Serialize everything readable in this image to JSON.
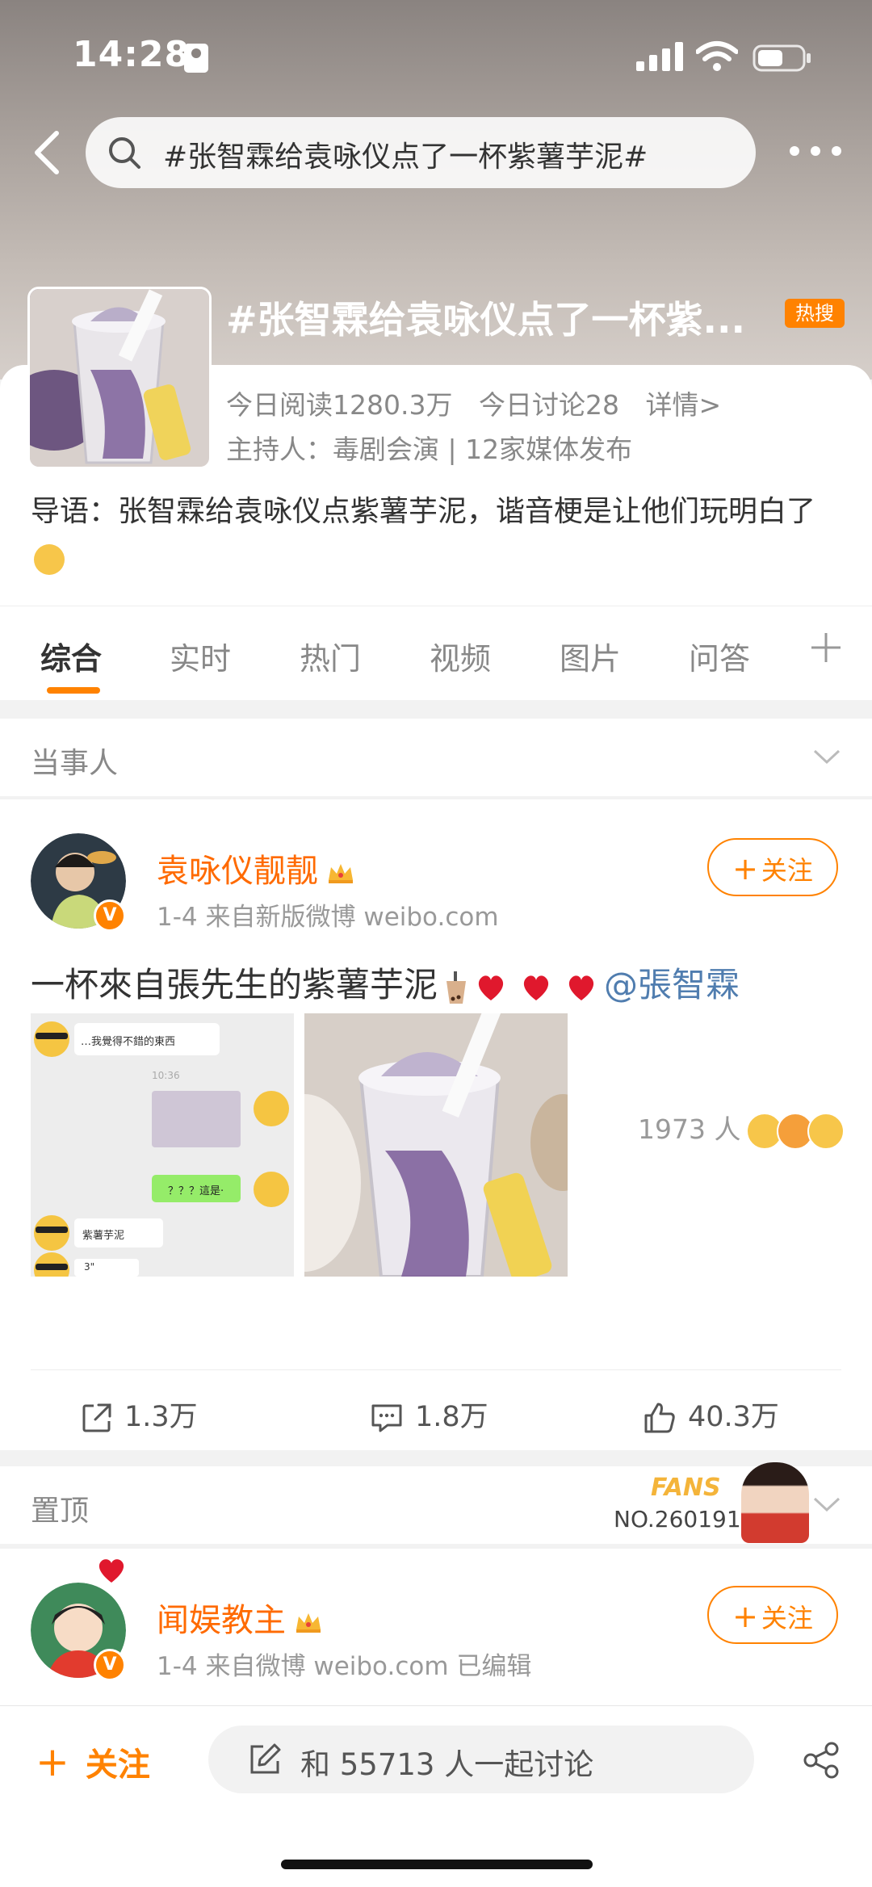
{
  "status": {
    "time": "14:28"
  },
  "search": {
    "query": "#张智霖给袁咏仪点了一杯紫薯芋泥#"
  },
  "topic": {
    "title": "#张智霖给袁咏仪点了一杯紫...",
    "hot_badge": "热搜",
    "reads": "今日阅读1280.3万",
    "discussions": "今日讨论28",
    "details": "详情>",
    "host": "主持人：毒剧会演 | 12家媒体发布",
    "intro": "导语：张智霖给袁咏仪点紫薯芋泥，谐音梗是让他们玩明白了"
  },
  "tabs": [
    {
      "label": "综合",
      "active": true
    },
    {
      "label": "实时"
    },
    {
      "label": "热门"
    },
    {
      "label": "视频"
    },
    {
      "label": "图片"
    },
    {
      "label": "问答"
    }
  ],
  "section_parties": {
    "label": "当事人"
  },
  "post1": {
    "user": "袁咏仪靓靓",
    "meta": "1-4  来自新版微博 weibo.com",
    "follow": "关注",
    "text": "一杯來自張先生的紫薯芋泥",
    "mention": "@張智霖",
    "chat": {
      "line1": "…我覺得不錯的東西",
      "time": "10:36",
      "line2": "？？？這是·",
      "line3": "紫薯芋泥",
      "line4": "3\""
    },
    "likers": "1973 人",
    "reposts": "1.3万",
    "comments": "1.8万",
    "likes": "40.3万"
  },
  "section_pinned": {
    "label": "置顶"
  },
  "fans": {
    "title": "FANS",
    "number": "NO.260191"
  },
  "post2": {
    "user": "闻娱教主",
    "meta": "1-4  来自微博 weibo.com  已编辑",
    "follow": "关注"
  },
  "bottom": {
    "follow": "关注",
    "discuss": "和 55713 人一起讨论"
  },
  "colors": {
    "accent": "#ff8200",
    "link": "#507daf",
    "username": "#ff6a00"
  }
}
